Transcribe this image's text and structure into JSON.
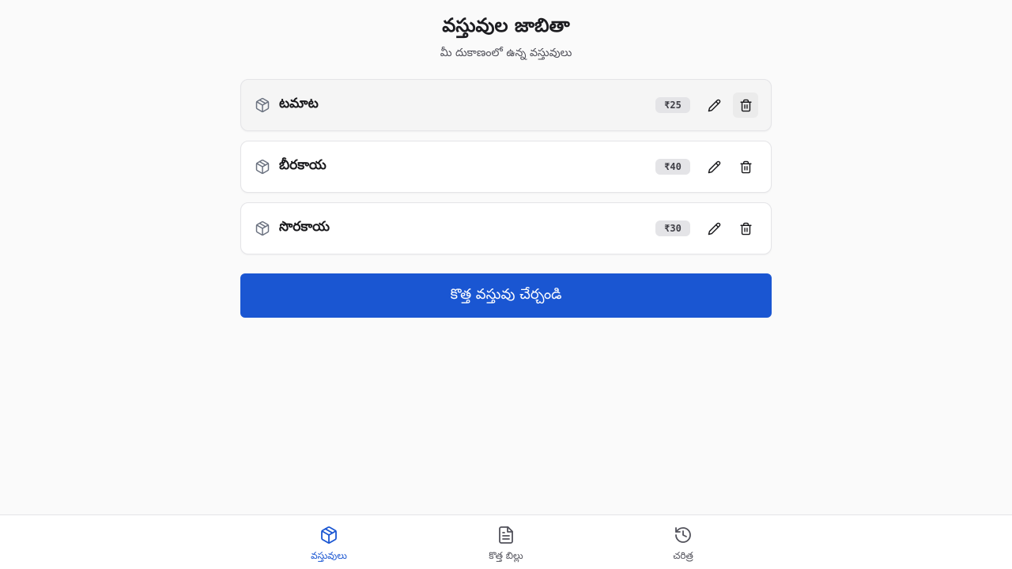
{
  "header": {
    "title": "వస్తువుల జాబితా",
    "subtitle": "మీ దుకాణంలో ఉన్న వస్తువులు"
  },
  "items": [
    {
      "name": "టమాట",
      "price": "₹25",
      "icon": "package-icon"
    },
    {
      "name": "బీరకాయ",
      "price": "₹40",
      "icon": "package-icon"
    },
    {
      "name": "సొరకాయ",
      "price": "₹30",
      "icon": "package-icon"
    }
  ],
  "actions": {
    "add_label": "కొత్త వస్తువు చేర్చండి"
  },
  "bottom_nav": [
    {
      "label": "వస్తువులు",
      "icon": "package-icon",
      "active": true
    },
    {
      "label": "కొత్త బిల్లు",
      "icon": "file-text-icon",
      "active": false
    },
    {
      "label": "చరిత్ర",
      "icon": "history-icon",
      "active": false
    }
  ],
  "colors": {
    "primary": "#1a56d2",
    "background": "#fafafa"
  }
}
